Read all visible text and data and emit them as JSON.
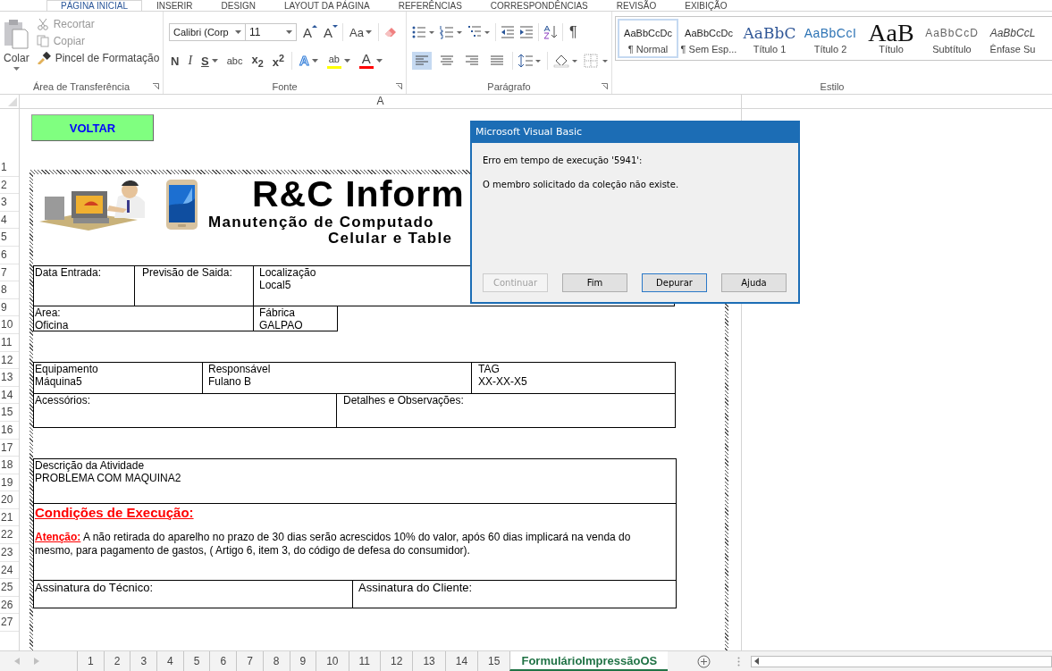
{
  "ribbon_tabs": [
    {
      "label": "PÁGINA INICIAL",
      "selected": true
    },
    {
      "label": "INSERIR",
      "selected": false
    },
    {
      "label": "DESIGN",
      "selected": false
    },
    {
      "label": "LAYOUT DA PÁGINA",
      "selected": false
    },
    {
      "label": "REFERÊNCIAS",
      "selected": false
    },
    {
      "label": "CORRESPONDÊNCIAS",
      "selected": false
    },
    {
      "label": "REVISÃO",
      "selected": false
    },
    {
      "label": "EXIBIÇÃO",
      "selected": false
    }
  ],
  "clipboard": {
    "paste": "Colar",
    "actions": [
      {
        "label": "Recortar",
        "disabled": true
      },
      {
        "label": "Copiar",
        "disabled": true
      },
      {
        "label": "Pincel de Formatação",
        "disabled": false
      }
    ],
    "group_label": "Área de Transferência"
  },
  "font": {
    "family": "Calibri (Corp",
    "size": "11",
    "size_buttons": [
      {
        "label": "A",
        "kind": "grow"
      },
      {
        "label": "A",
        "kind": "shrink"
      }
    ],
    "case_button": "Aa",
    "format_buttons": [
      {
        "label": "N",
        "kind": "bold"
      },
      {
        "label": "I",
        "kind": "italic"
      },
      {
        "label": "S",
        "kind": "underline"
      },
      {
        "label": "abc",
        "kind": "strike"
      },
      {
        "label": "x$_{2}$",
        "kind": "script"
      },
      {
        "label": "x$^{2}$",
        "kind": "script"
      }
    ],
    "effect_buttons": [
      {
        "label": "A",
        "kind": "text-effects"
      },
      {
        "label": "ab",
        "kind": "highlight",
        "color": "#ffff00"
      },
      {
        "label": "A",
        "kind": "font-color",
        "color": "#ff0000"
      }
    ],
    "group_label": "Fonte"
  },
  "paragraph": {
    "pilcrow": "¶",
    "alignment": [
      {
        "selected": true
      },
      {
        "selected": false
      },
      {
        "selected": false
      },
      {
        "selected": false
      }
    ],
    "group_label": "Parágrafo"
  },
  "styles": {
    "items": [
      {
        "preview": "AaBbCcDc",
        "label": "¶ Normal",
        "kind": "normal",
        "selected": true
      },
      {
        "preview": "AaBbCcDc",
        "label": "¶ Sem Esp...",
        "kind": "normal",
        "selected": false
      },
      {
        "preview": "AaBbC",
        "label": "Título 1",
        "kind": "heading1",
        "selected": false
      },
      {
        "preview": "AaBbCcI",
        "label": "Título 2",
        "kind": "heading2",
        "selected": false
      },
      {
        "preview": "AaB",
        "label": "Título",
        "kind": "title",
        "selected": false
      },
      {
        "preview": "AaBbCcD",
        "label": "Subtítulo",
        "kind": "subtitle",
        "selected": false
      },
      {
        "preview": "AaBbCcL",
        "label": "Ênfase Su",
        "kind": "emphasis",
        "selected": false
      }
    ],
    "group_label": "Estilo"
  },
  "column_header": "A",
  "row_numbers": [
    "1",
    "2",
    "3",
    "4",
    "5",
    "6",
    "7",
    "8",
    "9",
    "10",
    "11",
    "12",
    "13",
    "14",
    "15",
    "16",
    "17",
    "18",
    "19",
    "20",
    "21",
    "22",
    "23",
    "24",
    "25",
    "26",
    "27"
  ],
  "back_button": "VOLTAR",
  "form": {
    "title": "R&C Inform",
    "subtitle_1": "Manutenção de Computado",
    "subtitle_2": "Celular e Table",
    "entry_row": [
      {
        "label": "Data Entrada:"
      },
      {
        "label": "Previsão de Saida:"
      },
      {
        "label": "Localização",
        "value": "Local5"
      }
    ],
    "area_row": [
      {
        "label": "Area:",
        "value": "Oficina"
      },
      {
        "label": "Fábrica",
        "value": "GALPAO"
      }
    ],
    "equipment_row": [
      {
        "label": "Equipamento",
        "value": "Máquina5"
      },
      {
        "label": "Responsável",
        "value": "Fulano B"
      },
      {
        "label": "TAG",
        "value": "XX-XX-X5"
      }
    ],
    "notes_row": [
      {
        "label": "Acessórios:"
      },
      {
        "label": "Detalhes e Observações:"
      }
    ],
    "activity": {
      "label": "Descrição da Atividade",
      "value": "PROBLEMA COM MAQUINA2"
    },
    "conditions": {
      "heading": "Condições de Execução:",
      "attention_label": "Atenção:",
      "text": "A não retirada do aparelho no prazo de 30 dias serão acrescidos 10% do valor, após 60 dias implicará na venda do mesmo, para pagamento de gastos, ( Artigo 6, item 3, do código de defesa do consumidor)."
    },
    "signature_row": [
      {
        "label": "Assinatura do Técnico:"
      },
      {
        "label": "Assinatura do Cliente:"
      }
    ]
  },
  "dialog": {
    "title": "Microsoft Visual Basic",
    "messages": [
      "Erro em tempo de execução '5941':",
      "O membro solicitado da coleção não existe."
    ],
    "buttons": [
      {
        "label": "Continuar",
        "disabled": true,
        "focused": false
      },
      {
        "label": "Fim",
        "disabled": false,
        "focused": false
      },
      {
        "label": "Depurar",
        "disabled": false,
        "focused": true
      },
      {
        "label": "Ajuda",
        "disabled": false,
        "focused": false
      }
    ]
  },
  "sheet_tabs": [
    {
      "label": "1",
      "selected": false
    },
    {
      "label": "2",
      "selected": false
    },
    {
      "label": "3",
      "selected": false
    },
    {
      "label": "4",
      "selected": false
    },
    {
      "label": "5",
      "selected": false
    },
    {
      "label": "6",
      "selected": false
    },
    {
      "label": "7",
      "selected": false
    },
    {
      "label": "8",
      "selected": false
    },
    {
      "label": "9",
      "selected": false
    },
    {
      "label": "10",
      "selected": false
    },
    {
      "label": "11",
      "selected": false
    },
    {
      "label": "12",
      "selected": false
    },
    {
      "label": "13",
      "selected": false
    },
    {
      "label": "14",
      "selected": false
    },
    {
      "label": "15",
      "selected": false
    },
    {
      "label": "FormulárioImpressãoOS",
      "selected": true
    }
  ]
}
